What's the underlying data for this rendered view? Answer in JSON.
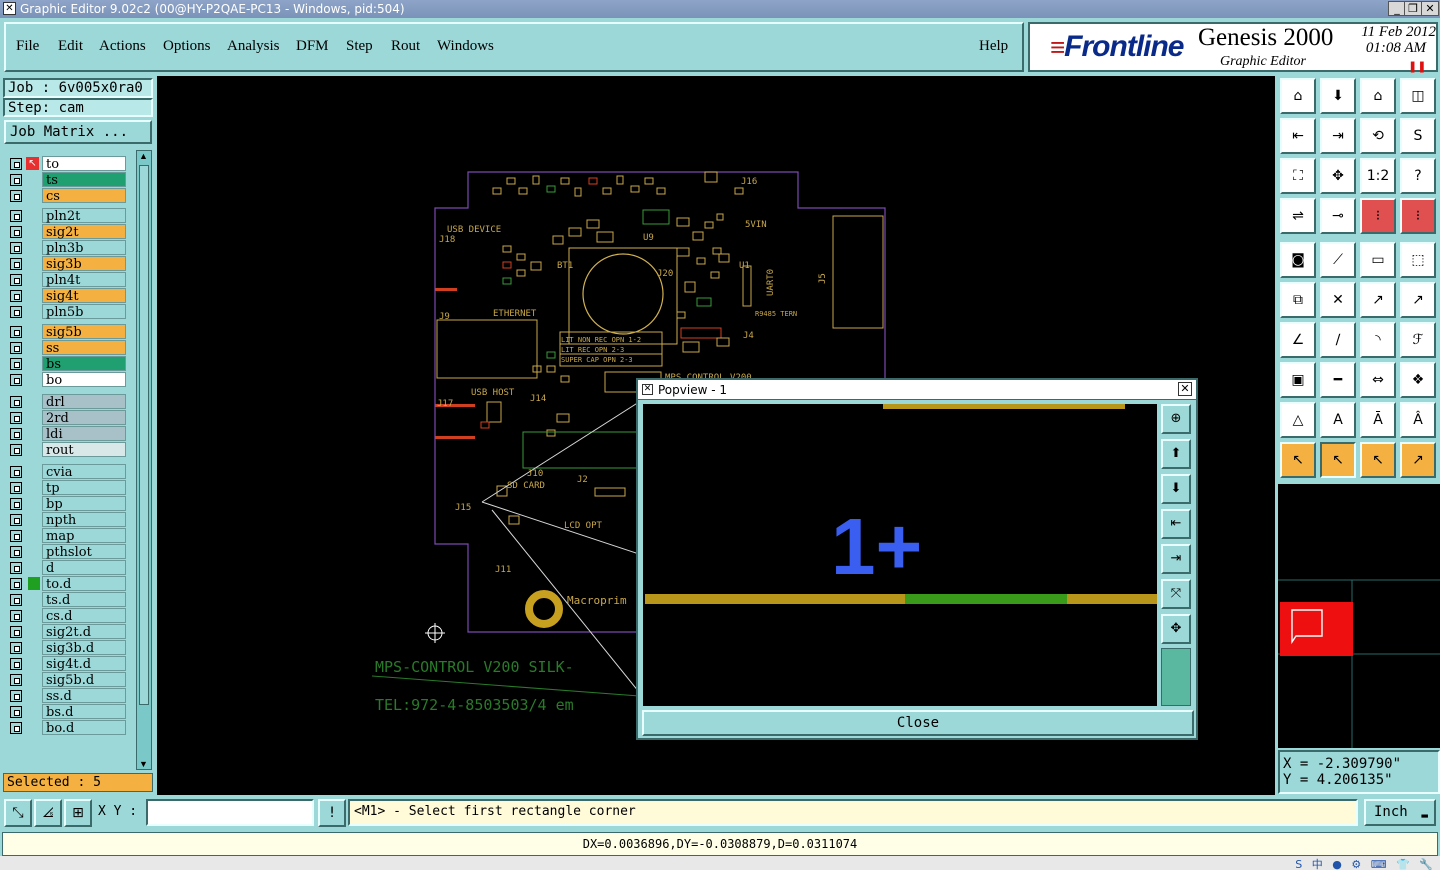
{
  "window": {
    "title": "Graphic Editor 9.02c2 (00@HY-P2QAE-PC13 - Windows, pid:504)"
  },
  "menu": {
    "items": [
      "File",
      "Edit",
      "Actions",
      "Options",
      "Analysis",
      "DFM",
      "Step",
      "Rout",
      "Windows"
    ],
    "help": "Help"
  },
  "brand": {
    "logo": "Frontline",
    "product": "Genesis 2000",
    "subtitle": "Graphic Editor",
    "date": "11 Feb 2012",
    "time": "01:08 AM"
  },
  "job": {
    "job_label": "Job : 6v005x0ra0",
    "step_label": "Step: cam",
    "matrix_button": "Job Matrix ..."
  },
  "layers": [
    {
      "name": "to",
      "color": "#ffffff",
      "work": true,
      "mark": "✎▪"
    },
    {
      "name": "ts",
      "color": "#20a070"
    },
    {
      "name": "cs",
      "color": "#f4b040"
    },
    {
      "name": "pln2t",
      "color": "#9cd8d8"
    },
    {
      "name": "sig2t",
      "color": "#f4b040"
    },
    {
      "name": "pln3b",
      "color": "#9cd8d8"
    },
    {
      "name": "sig3b",
      "color": "#f4b040"
    },
    {
      "name": "pln4t",
      "color": "#9cd8d8"
    },
    {
      "name": "sig4t",
      "color": "#f4b040"
    },
    {
      "name": "pln5b",
      "color": "#9cd8d8"
    },
    {
      "name": "sig5b",
      "color": "#f4b040"
    },
    {
      "name": "ss",
      "color": "#f4b040"
    },
    {
      "name": "bs",
      "color": "#20a070"
    },
    {
      "name": "bo",
      "color": "#ffffff",
      "mark": "✎"
    },
    {
      "name": "drl",
      "color": "#a8c0c8"
    },
    {
      "name": "2rd",
      "color": "#a8c0c8"
    },
    {
      "name": "ldi",
      "color": "#a8c0c8"
    },
    {
      "name": "rout",
      "color": "#d8e8e8"
    },
    {
      "name": "cvia",
      "color": "#9cd8d8"
    },
    {
      "name": "tp",
      "color": "#9cd8d8"
    },
    {
      "name": "bp",
      "color": "#9cd8d8"
    },
    {
      "name": "npth",
      "color": "#9cd8d8"
    },
    {
      "name": "map",
      "color": "#9cd8d8"
    },
    {
      "name": "pthslot",
      "color": "#9cd8d8"
    },
    {
      "name": "d",
      "color": "#9cd8d8"
    },
    {
      "name": "to.d",
      "color": "#9cd8d8",
      "mark": "✎"
    },
    {
      "name": "ts.d",
      "color": "#9cd8d8"
    },
    {
      "name": "cs.d",
      "color": "#9cd8d8"
    },
    {
      "name": "sig2t.d",
      "color": "#9cd8d8"
    },
    {
      "name": "sig3b.d",
      "color": "#9cd8d8"
    },
    {
      "name": "sig4t.d",
      "color": "#9cd8d8"
    },
    {
      "name": "sig5b.d",
      "color": "#9cd8d8"
    },
    {
      "name": "ss.d",
      "color": "#9cd8d8"
    },
    {
      "name": "bs.d",
      "color": "#9cd8d8"
    },
    {
      "name": "bo.d",
      "color": "#9cd8d8",
      "mark": "✎"
    }
  ],
  "selected": "Selected : 5",
  "board_text": {
    "usb_device": "USB DEVICE",
    "j18": "J18",
    "j16": "J16",
    "fivevin": "5VIN",
    "ethernet": "ETHERNET",
    "usb_host": "USB HOST",
    "j15": "J15",
    "lcd_opt": "LCD OPT",
    "sd_card": "SD CARD",
    "bt1": "BT1",
    "j20": "J20",
    "mps": "MPS CONTROL V200",
    "silk_line1": "MPS-CONTROL V200  SILK-",
    "silk_line2": "TEL:972-4-8503503/4 em",
    "macroprim": "Macroprim",
    "j5": "J5",
    "j9": "J9",
    "j17": "J17",
    "j14": "J14",
    "j10": "J10",
    "j2": "J2",
    "j11": "J11",
    "u9": "U9",
    "u1": "U1",
    "uart0": "UART0",
    "j4": "J4",
    "term": "R9485 TERN",
    "table_rows": [
      "LIT NON REC  OPN 1-2",
      "LIT REC      OPN 2-3",
      "SUPER CAP    OPN 2-3"
    ]
  },
  "coordinates": {
    "x": "X = -2.309790\"",
    "y": "Y = 4.206135\""
  },
  "bottom": {
    "xy_label": "X Y :",
    "xy_value": "",
    "prompt": "<M1> - Select first rectangle corner",
    "units": "Inch",
    "status": "DX=0.0036896,DY=-0.0308879,D=0.0311074"
  },
  "popview": {
    "title": "Popview - 1",
    "callout": "1+",
    "close_label": "Close"
  },
  "colors": {
    "panel": "#9cd8d8",
    "accent_orange": "#f4b040",
    "callout_blue": "#3a5ef0",
    "trace_gold": "#b8961a",
    "trace_green": "#3a9a1a",
    "silk_green": "#2a7a2a",
    "outline_purple": "#7a4ab0"
  }
}
